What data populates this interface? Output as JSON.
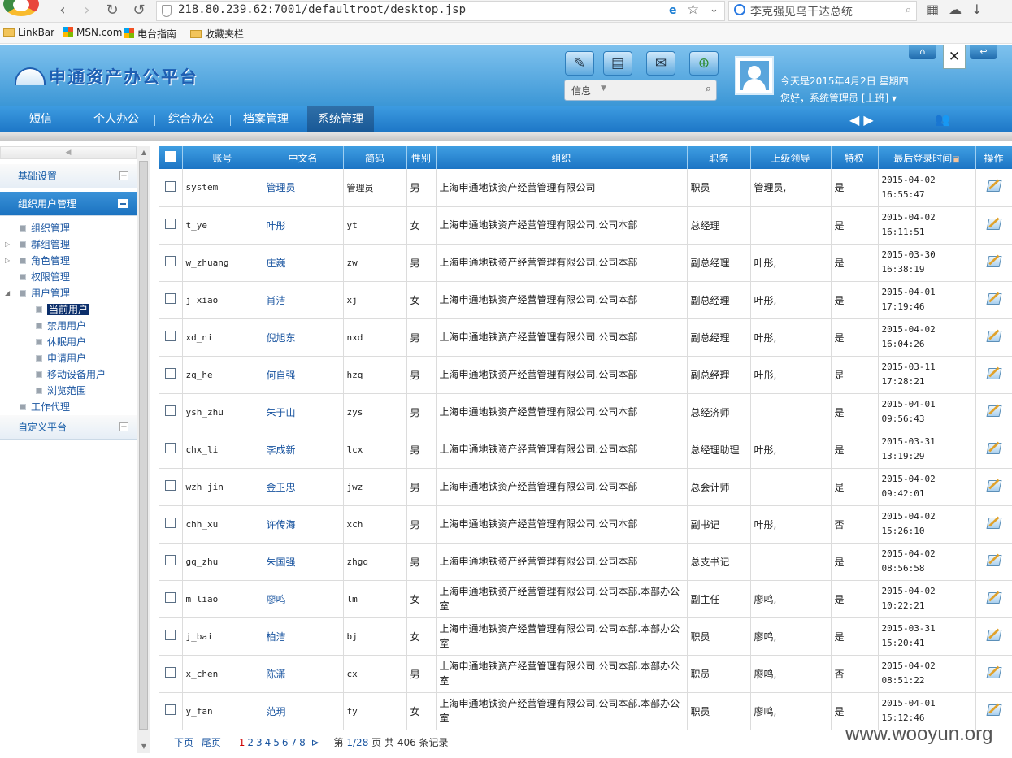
{
  "browser": {
    "url": "218.80.239.62:7001/defaultroot/desktop.jsp",
    "search_text": "李克强见乌干达总统",
    "bookmarks": [
      "LinkBar",
      "MSN.com",
      "电台指南",
      "收藏夹栏"
    ]
  },
  "header": {
    "app_title": "申通资产办公平台",
    "info_select": "信息",
    "date_text": "今天是2015年4月2日 星期四",
    "greeting": "您好，系统管理员 [上班] ▾"
  },
  "nav": {
    "items": [
      "短信",
      "个人办公",
      "综合办公",
      "档案管理",
      "系统管理"
    ],
    "active": "系统管理"
  },
  "sidebar": {
    "sections": [
      {
        "label": "基础设置",
        "expanded": false
      },
      {
        "label": "组织用户管理",
        "expanded": true
      },
      {
        "label": "自定义平台",
        "expanded": false
      }
    ],
    "tree": [
      {
        "label": "组织管理"
      },
      {
        "label": "群组管理"
      },
      {
        "label": "角色管理"
      },
      {
        "label": "权限管理"
      },
      {
        "label": "用户管理"
      },
      {
        "label": "当前用户",
        "selected": true
      },
      {
        "label": "禁用用户"
      },
      {
        "label": "休眠用户"
      },
      {
        "label": "申请用户"
      },
      {
        "label": "移动设备用户"
      },
      {
        "label": "浏览范围"
      },
      {
        "label": "工作代理"
      }
    ]
  },
  "table": {
    "columns": [
      "账号",
      "中文名",
      "简码",
      "性别",
      "组织",
      "职务",
      "上级领导",
      "特权",
      "最后登录时间",
      "操作"
    ],
    "rows": [
      {
        "account": "system",
        "name": "管理员",
        "code": "管理员",
        "gender": "男",
        "org": "上海申通地铁资产经营管理有限公司",
        "title": "职员",
        "leader": "管理员,",
        "priv": "是",
        "last_login": "2015-04-02 16:55:47"
      },
      {
        "account": "t_ye",
        "name": "叶彤",
        "code": "yt",
        "gender": "女",
        "org": "上海申通地铁资产经营管理有限公司.公司本部",
        "title": "总经理",
        "leader": "",
        "priv": "是",
        "last_login": "2015-04-02 16:11:51"
      },
      {
        "account": "w_zhuang",
        "name": "庄巍",
        "code": "zw",
        "gender": "男",
        "org": "上海申通地铁资产经营管理有限公司.公司本部",
        "title": "副总经理",
        "leader": "叶彤,",
        "priv": "是",
        "last_login": "2015-03-30 16:38:19"
      },
      {
        "account": "j_xiao",
        "name": "肖洁",
        "code": "xj",
        "gender": "女",
        "org": "上海申通地铁资产经营管理有限公司.公司本部",
        "title": "副总经理",
        "leader": "叶彤,",
        "priv": "是",
        "last_login": "2015-04-01 17:19:46"
      },
      {
        "account": "xd_ni",
        "name": "倪旭东",
        "code": "nxd",
        "gender": "男",
        "org": "上海申通地铁资产经营管理有限公司.公司本部",
        "title": "副总经理",
        "leader": "叶彤,",
        "priv": "是",
        "last_login": "2015-04-02 16:04:26"
      },
      {
        "account": "zq_he",
        "name": "何自强",
        "code": "hzq",
        "gender": "男",
        "org": "上海申通地铁资产经营管理有限公司.公司本部",
        "title": "副总经理",
        "leader": "叶彤,",
        "priv": "是",
        "last_login": "2015-03-11 17:28:21"
      },
      {
        "account": "ysh_zhu",
        "name": "朱于山",
        "code": "zys",
        "gender": "男",
        "org": "上海申通地铁资产经营管理有限公司.公司本部",
        "title": "总经济师",
        "leader": "",
        "priv": "是",
        "last_login": "2015-04-01 09:56:43"
      },
      {
        "account": "chx_li",
        "name": "李成新",
        "code": "lcx",
        "gender": "男",
        "org": "上海申通地铁资产经营管理有限公司.公司本部",
        "title": "总经理助理",
        "leader": "叶彤,",
        "priv": "是",
        "last_login": "2015-03-31 13:19:29"
      },
      {
        "account": "wzh_jin",
        "name": "金卫忠",
        "code": "jwz",
        "gender": "男",
        "org": "上海申通地铁资产经营管理有限公司.公司本部",
        "title": "总会计师",
        "leader": "",
        "priv": "是",
        "last_login": "2015-04-02 09:42:01"
      },
      {
        "account": "chh_xu",
        "name": "许传海",
        "code": "xch",
        "gender": "男",
        "org": "上海申通地铁资产经营管理有限公司.公司本部",
        "title": "副书记",
        "leader": "叶彤,",
        "priv": "否",
        "last_login": "2015-04-02 15:26:10"
      },
      {
        "account": "gq_zhu",
        "name": "朱国强",
        "code": "zhgq",
        "gender": "男",
        "org": "上海申通地铁资产经营管理有限公司.公司本部",
        "title": "总支书记",
        "leader": "",
        "priv": "是",
        "last_login": "2015-04-02 08:56:58"
      },
      {
        "account": "m_liao",
        "name": "廖鸣",
        "code": "lm",
        "gender": "女",
        "org": "上海申通地铁资产经营管理有限公司.公司本部.本部办公室",
        "title": "副主任",
        "leader": "廖鸣,",
        "priv": "是",
        "last_login": "2015-04-02 10:22:21"
      },
      {
        "account": "j_bai",
        "name": "柏洁",
        "code": "bj",
        "gender": "女",
        "org": "上海申通地铁资产经营管理有限公司.公司本部.本部办公室",
        "title": "职员",
        "leader": "廖鸣,",
        "priv": "是",
        "last_login": "2015-03-31 15:20:41"
      },
      {
        "account": "x_chen",
        "name": "陈潇",
        "code": "cx",
        "gender": "男",
        "org": "上海申通地铁资产经营管理有限公司.公司本部.本部办公室",
        "title": "职员",
        "leader": "廖鸣,",
        "priv": "否",
        "last_login": "2015-04-02 08:51:22"
      },
      {
        "account": "y_fan",
        "name": "范玥",
        "code": "fy",
        "gender": "女",
        "org": "上海申通地铁资产经营管理有限公司.公司本部.本部办公室",
        "title": "职员",
        "leader": "廖鸣,",
        "priv": "是",
        "last_login": "2015-04-01 15:12:46"
      }
    ]
  },
  "pager": {
    "next": "下页",
    "last": "尾页",
    "pages": [
      "1",
      "2",
      "3",
      "4",
      "5",
      "6",
      "7",
      "8"
    ],
    "current": "1",
    "summary_prefix": "第",
    "current_page": "1/28",
    "summary_mid": "页 共",
    "total": "406",
    "summary_suffix": "条记录"
  },
  "watermark": "www.wooyun.org"
}
